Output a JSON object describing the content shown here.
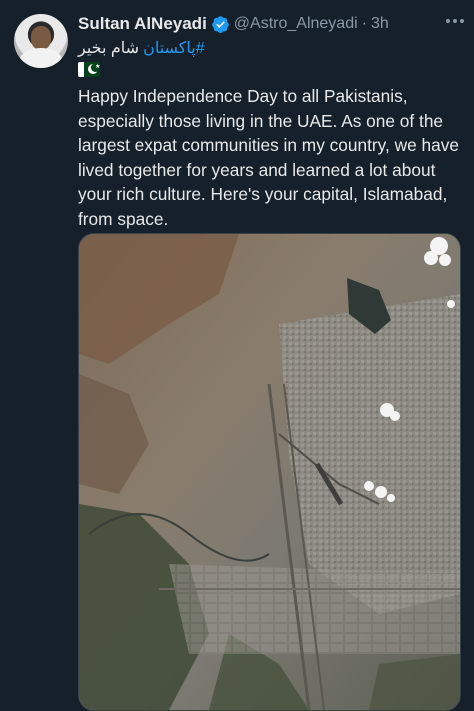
{
  "author": {
    "name": "Sultan AlNeyadi",
    "handle": "@Astro_Alneyadi",
    "separator": "·",
    "time": "3h"
  },
  "tweet": {
    "urdu_text": "شام بخیر",
    "hashtag": "#پاکستان",
    "body": "Happy Independence Day to all Pakistanis, especially those living in the UAE. As one of the largest expat communities in my country, we have lived together for years and learned a lot about your rich culture. Here's your capital, Islamabad, from space."
  },
  "icons": {
    "verified": "verified-badge-icon",
    "more": "more-options-icon",
    "flag": "pakistan-flag-icon"
  },
  "colors": {
    "background": "#15202b",
    "link": "#1d9bf0",
    "verified": "#1d9bf0",
    "muted": "#8b98a5"
  }
}
